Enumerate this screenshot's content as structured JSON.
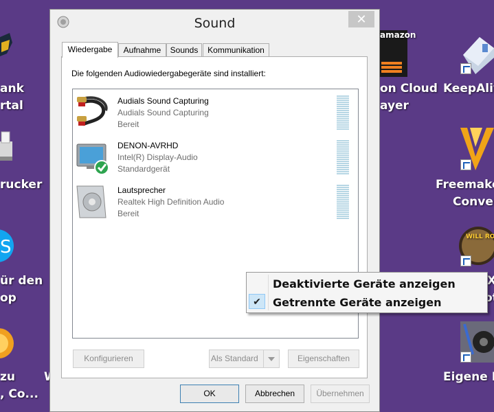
{
  "desktop": {
    "left_icons": [
      {
        "label_1": "ank",
        "label_2": "rtal",
        "icon": "bank-portal-icon"
      },
      {
        "label_1": "rucker",
        "label_2": "",
        "icon": "printer-icon"
      },
      {
        "label_1": "ür den",
        "label_2": "op",
        "icon": "skype-icon"
      },
      {
        "label_1": "zu",
        "label_2": ", Co...",
        "icon": "app-icon"
      }
    ],
    "middle_labels": [
      {
        "label_1": "on Cloud",
        "label_2": "ayer",
        "icon": "amazon-music-icon",
        "logo_text": "amazon"
      }
    ],
    "right_icons": [
      {
        "label_1": "KeepAliv",
        "label_2": "",
        "icon": "usb-drive-icon"
      },
      {
        "label_1": "Freemake",
        "label_2": "Conver",
        "icon": "freemake-icon"
      },
      {
        "label_1": "X",
        "label_2": "ot",
        "icon": "game-icon",
        "logo_text": "WILL ROCK"
      },
      {
        "label_1": "Eigene M",
        "label_2": "",
        "icon": "music-speaker-icon"
      }
    ],
    "stray_letter": "W"
  },
  "dialog": {
    "title": "Sound",
    "close_label": "✕",
    "tabs": [
      {
        "label": "Wiedergabe",
        "active": true
      },
      {
        "label": "Aufnahme",
        "active": false
      },
      {
        "label": "Sounds",
        "active": false
      },
      {
        "label": "Kommunikation",
        "active": false
      }
    ],
    "description": "Die folgenden Audiowiedergabegeräte sind installiert:",
    "devices": [
      {
        "name": "Audials Sound Capturing",
        "driver": "Audials Sound Capturing",
        "status": "Bereit",
        "icon": "rca-cable-icon"
      },
      {
        "name": "DENON-AVRHD",
        "driver": "Intel(R) Display-Audio",
        "status": "Standardgerät",
        "icon": "monitor-default-icon"
      },
      {
        "name": "Lautsprecher",
        "driver": "Realtek High Definition Audio",
        "status": "Bereit",
        "icon": "speaker-icon"
      }
    ],
    "buttons": {
      "configure": "Konfigurieren",
      "set_default": "Als Standard",
      "properties": "Eigenschaften",
      "ok": "OK",
      "cancel": "Abbrechen",
      "apply": "Übernehmen"
    }
  },
  "context_menu": {
    "items": [
      {
        "label": "Deaktivierte Geräte anzeigen",
        "checked": false
      },
      {
        "label": "Getrennte Geräte anzeigen",
        "checked": true
      }
    ],
    "check_glyph": "✔"
  },
  "colors": {
    "desktop_bg": "#5a3a86",
    "meter": "#b6d6e4",
    "check_bg": "#cde6f7"
  }
}
